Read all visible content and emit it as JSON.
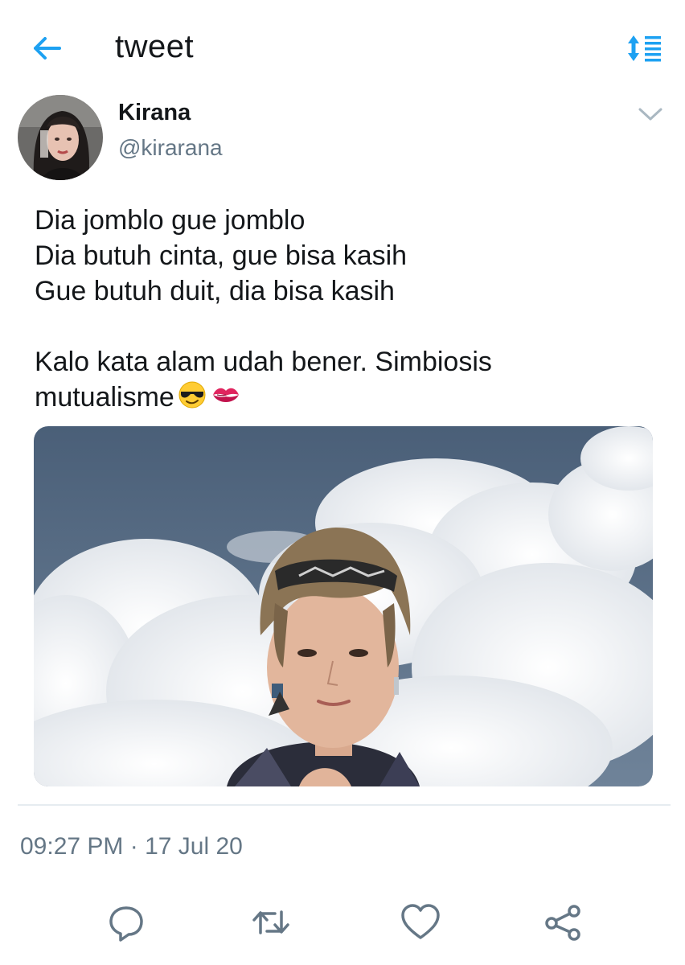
{
  "header": {
    "title": "tweet",
    "back_icon": "arrow-left-icon",
    "sort_icon": "sort-lines-icon",
    "accent_color": "#1da1f2"
  },
  "tweet": {
    "author_name": "Kirana",
    "author_handle": "@kirarana",
    "menu_icon": "chevron-down-icon",
    "lines": [
      "Dia jomblo gue jomblo",
      "Dia butuh cinta, gue bisa kasih",
      "Gue butuh duit, dia bisa kasih",
      "",
      "Kalo kata alam udah bener. Simbiosis",
      "mutualisme"
    ],
    "emojis": [
      "sunglasses-emoji",
      "kiss-mark-emoji"
    ],
    "media": "photo of a young man with a headband in front of a cloudy blue sky",
    "timestamp": "09:27 PM · 17 Jul 20"
  },
  "actions": [
    {
      "icon": "reply-icon"
    },
    {
      "icon": "retweet-icon"
    },
    {
      "icon": "like-heart-icon"
    },
    {
      "icon": "share-icon"
    }
  ]
}
